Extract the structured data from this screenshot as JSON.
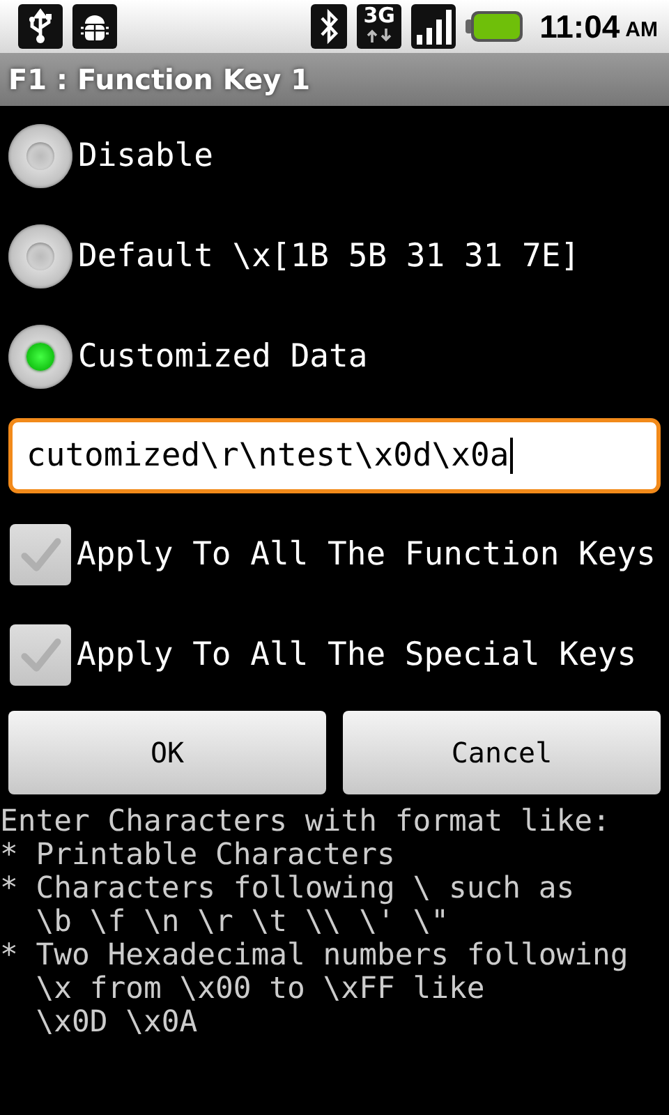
{
  "status_bar": {
    "network_type": "3G",
    "time": "11:04",
    "meridiem": "AM"
  },
  "dialog": {
    "title": "F1 : Function Key 1"
  },
  "options": [
    {
      "label": "Disable",
      "selected": false
    },
    {
      "label": "Default \\x[1B 5B 31 31 7E]",
      "selected": false
    },
    {
      "label": "Customized Data",
      "selected": true
    }
  ],
  "custom_data": {
    "value": "cutomized\\r\\ntest\\x0d\\x0a"
  },
  "checkboxes": [
    {
      "label": "Apply To All The Function Keys",
      "checked": false
    },
    {
      "label": "Apply To All The Special Keys",
      "checked": false
    }
  ],
  "buttons": [
    "OK",
    "Cancel"
  ],
  "help": "Enter Characters with format like:\n* Printable Characters\n* Characters following \\ such as\n  \\b \\f \\n \\r \\t \\\\ \\' \\\"\n* Two Hexadecimal numbers following\n  \\x from \\x00 to \\xFF like\n  \\x0D \\x0A"
}
